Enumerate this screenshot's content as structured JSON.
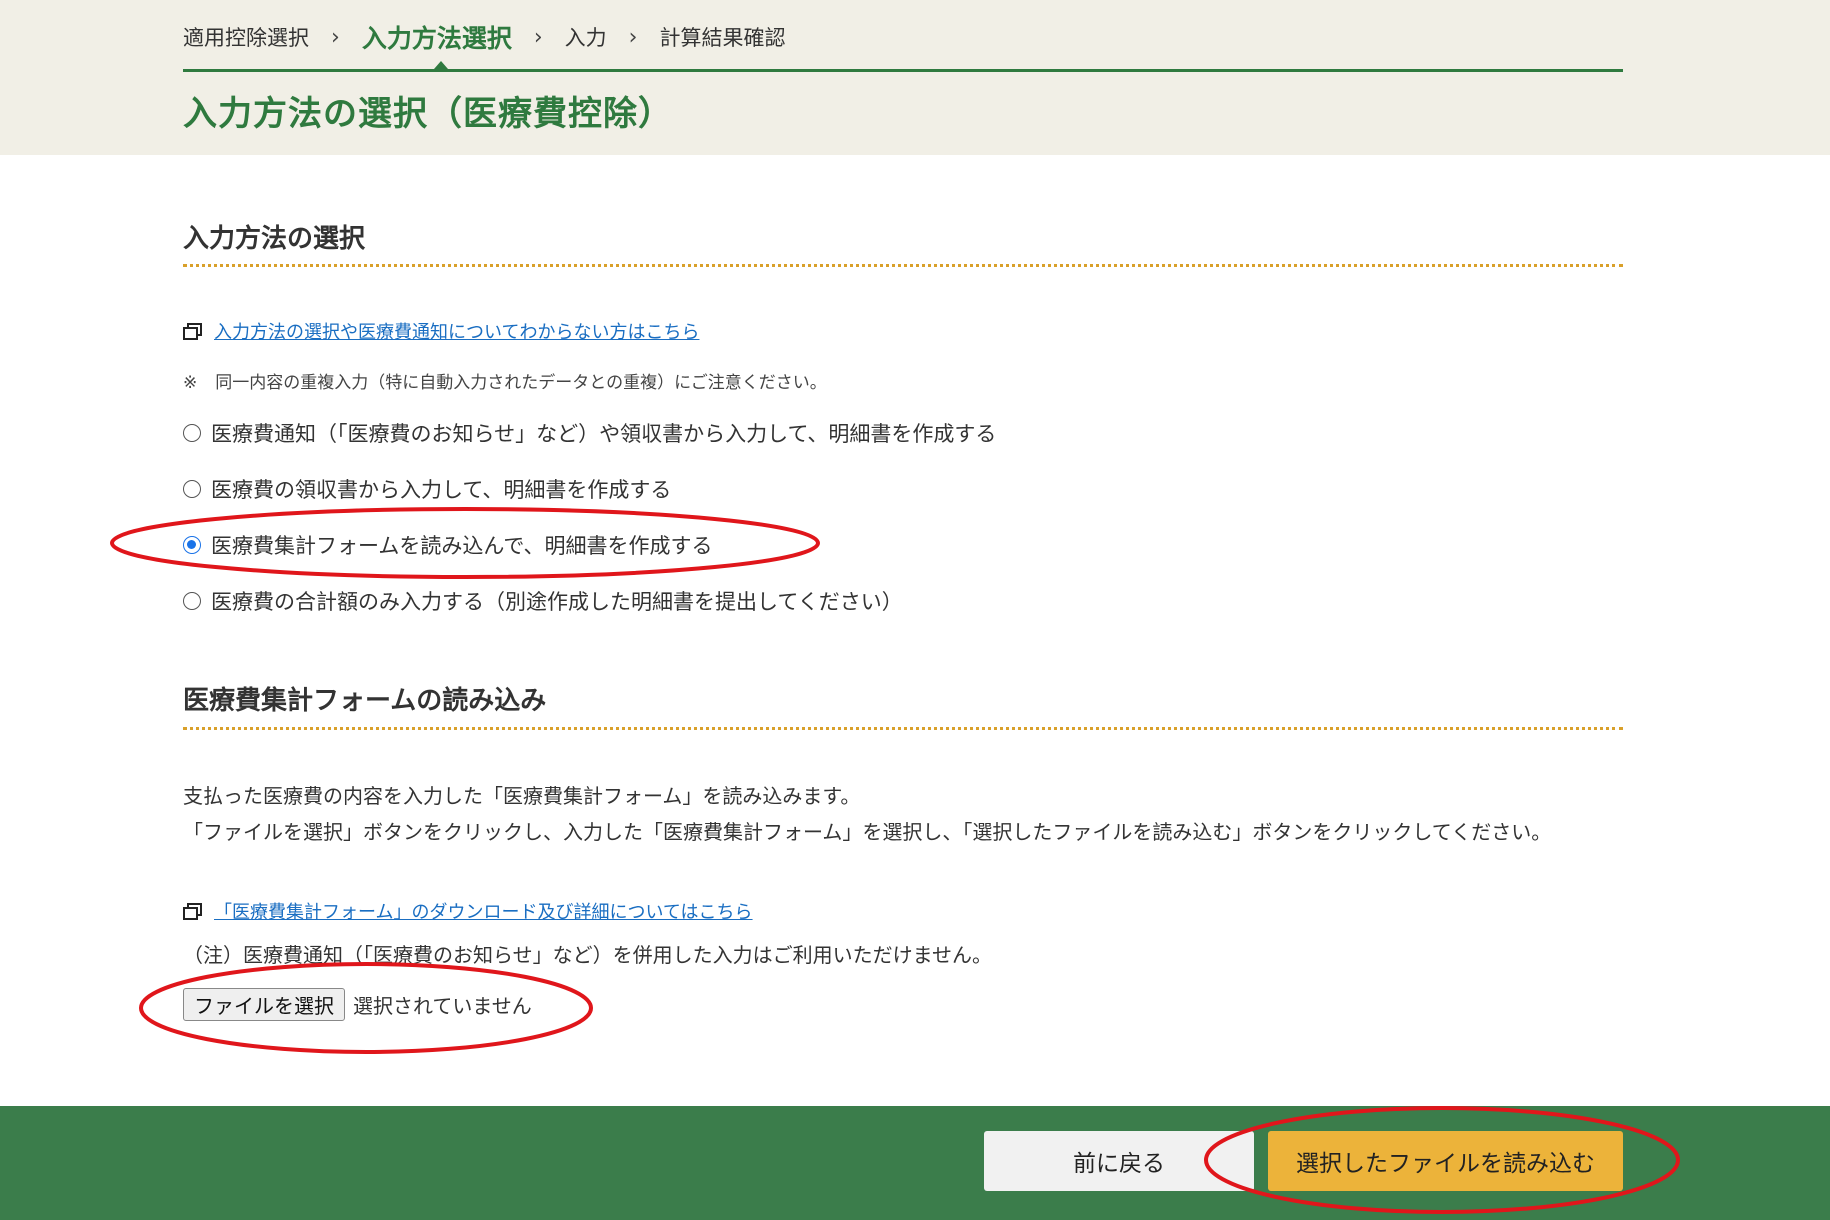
{
  "breadcrumb": {
    "steps": [
      "適用控除選択",
      "入力方法選択",
      "入力",
      "計算結果確認"
    ],
    "separator": "›",
    "current_index": 1
  },
  "page_title": "入力方法の選択（医療費控除）",
  "section1": {
    "heading": "入力方法の選択",
    "help_link": "入力方法の選択や医療費通知についてわからない方はこちら",
    "note_mark": "※",
    "note": "同一内容の重複入力（特に自動入力されたデータとの重複）にご注意ください。",
    "options": [
      {
        "label": "医療費通知（「医療費のお知らせ」など）や領収書から入力して、明細書を作成する",
        "checked": false
      },
      {
        "label": "医療費の領収書から入力して、明細書を作成する",
        "checked": false
      },
      {
        "label": "医療費集計フォームを読み込んで、明細書を作成する",
        "checked": true
      },
      {
        "label": "医療費の合計額のみ入力する（別途作成した明細書を提出してください）",
        "checked": false
      }
    ]
  },
  "section2": {
    "heading": "医療費集計フォームの読み込み",
    "line1": "支払った医療費の内容を入力した「医療費集計フォーム」を読み込みます。",
    "line2": "「ファイルを選択」ボタンをクリックし、入力した「医療費集計フォーム」を選択し、「選択したファイルを読み込む」ボタンをクリックしてください。",
    "download_link": "「医療費集計フォーム」のダウンロード及び詳細についてはこちら",
    "caution": "（注）医療費通知（「医療費のお知らせ」など）を併用した入力はご利用いただけません。",
    "file_button": "ファイルを選択",
    "file_status": "選択されていません"
  },
  "footer": {
    "back_button": "前に戻る",
    "load_button": "選択したファイルを読み込む"
  },
  "colors": {
    "header_bg": "#f1efe6",
    "accent_green": "#2f7a3f",
    "footer_green": "#3b7d4b",
    "dotted_rule": "#d9a02a",
    "primary_button": "#ecb33a",
    "annotation_red": "#e0161b"
  }
}
